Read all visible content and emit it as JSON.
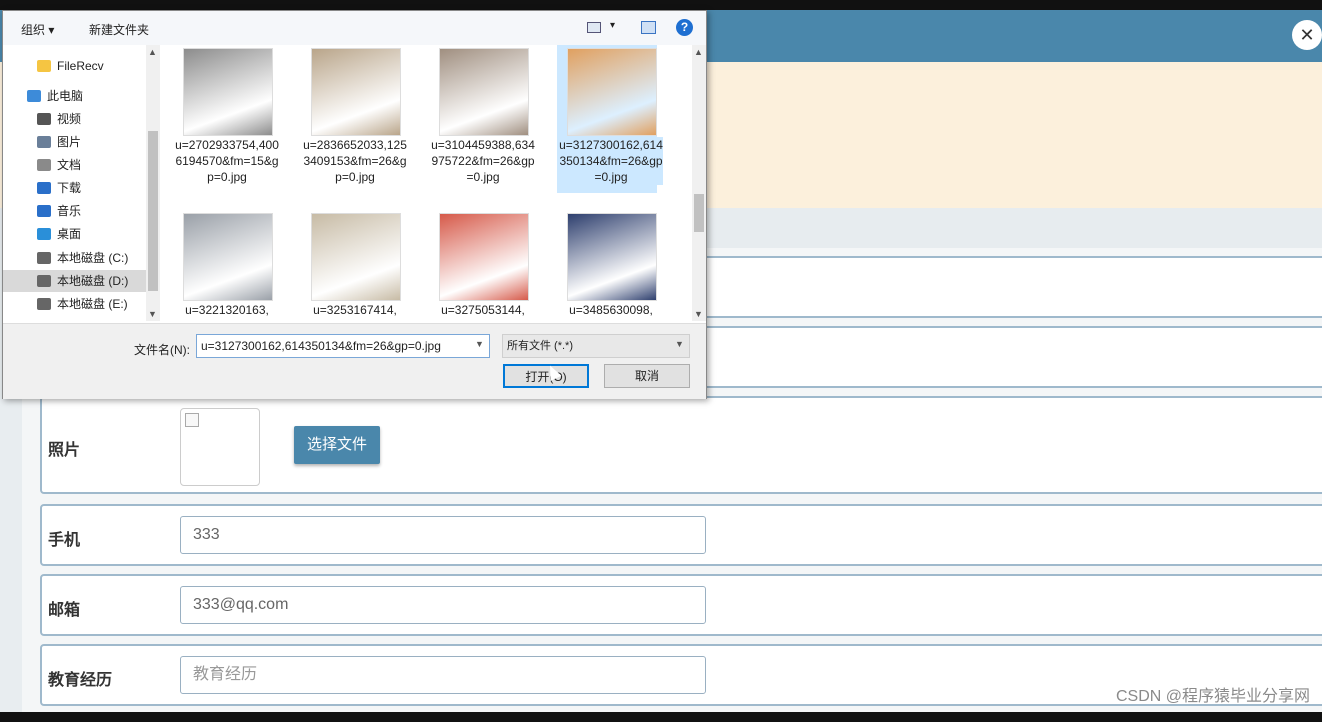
{
  "dialog": {
    "toolbar": {
      "organize": "组织 ▾",
      "new_folder": "新建文件夹",
      "view_arrow": "▾",
      "help": "?"
    },
    "nav": [
      {
        "label": "FileRecv",
        "icon": "folder-icon",
        "color": "#f5c542"
      },
      {
        "label": "此电脑",
        "icon": "computer-icon",
        "color": "#3d8bd9"
      },
      {
        "label": "视频",
        "icon": "video-icon",
        "color": "#555555"
      },
      {
        "label": "图片",
        "icon": "picture-icon",
        "color": "#6a7f99"
      },
      {
        "label": "文档",
        "icon": "document-icon",
        "color": "#8a8a8a"
      },
      {
        "label": "下载",
        "icon": "download-icon",
        "color": "#2a6fc9"
      },
      {
        "label": "音乐",
        "icon": "music-icon",
        "color": "#2a6fc9"
      },
      {
        "label": "桌面",
        "icon": "desktop-icon",
        "color": "#2a8fd9"
      },
      {
        "label": "本地磁盘 (C:)",
        "icon": "drive-icon",
        "color": "#666666"
      },
      {
        "label": "本地磁盘 (D:)",
        "icon": "drive-icon",
        "color": "#666666"
      },
      {
        "label": "本地磁盘 (E:)",
        "icon": "drive-icon",
        "color": "#666666"
      }
    ],
    "files": [
      {
        "name": "u=2702933754,4006194570&fm=15&gp=0.jpg",
        "color": "#8c8c8c"
      },
      {
        "name": "u=2836652033,1253409153&fm=26&gp=0.jpg",
        "color": "#b9a58a"
      },
      {
        "name": "u=3104459388,634975722&fm=26&gp=0.jpg",
        "color": "#a08f80"
      },
      {
        "name": "u=3127300162,614350134&fm=26&gp=0.jpg",
        "color": "#e0a060"
      },
      {
        "name": "u=3221320163,",
        "color": "#9aa0a8"
      },
      {
        "name": "u=3253167414,",
        "color": "#c7bba5"
      },
      {
        "name": "u=3275053144,",
        "color": "#d65a4a"
      },
      {
        "name": "u=3485630098,",
        "color": "#2e3f6e"
      }
    ],
    "filename_label": "文件名(N):",
    "filename_value": "u=3127300162,614350134&fm=26&gp=0.jpg",
    "filter": "所有文件 (*.*)",
    "open_button": "打开(O)",
    "cancel_button": "取消"
  },
  "form": {
    "photo_label": "照片",
    "choose_file": "选择文件",
    "phone_label": "手机",
    "phone_value": "333",
    "email_label": "邮箱",
    "email_value": "333@qq.com",
    "education_label": "教育经历",
    "education_placeholder": "教育经历"
  },
  "watermark": "CSDN @程序猿毕业分享网",
  "colors": {
    "header": "#4a87ab",
    "banner": "#fcf0dc",
    "selection": "#cce8ff"
  }
}
